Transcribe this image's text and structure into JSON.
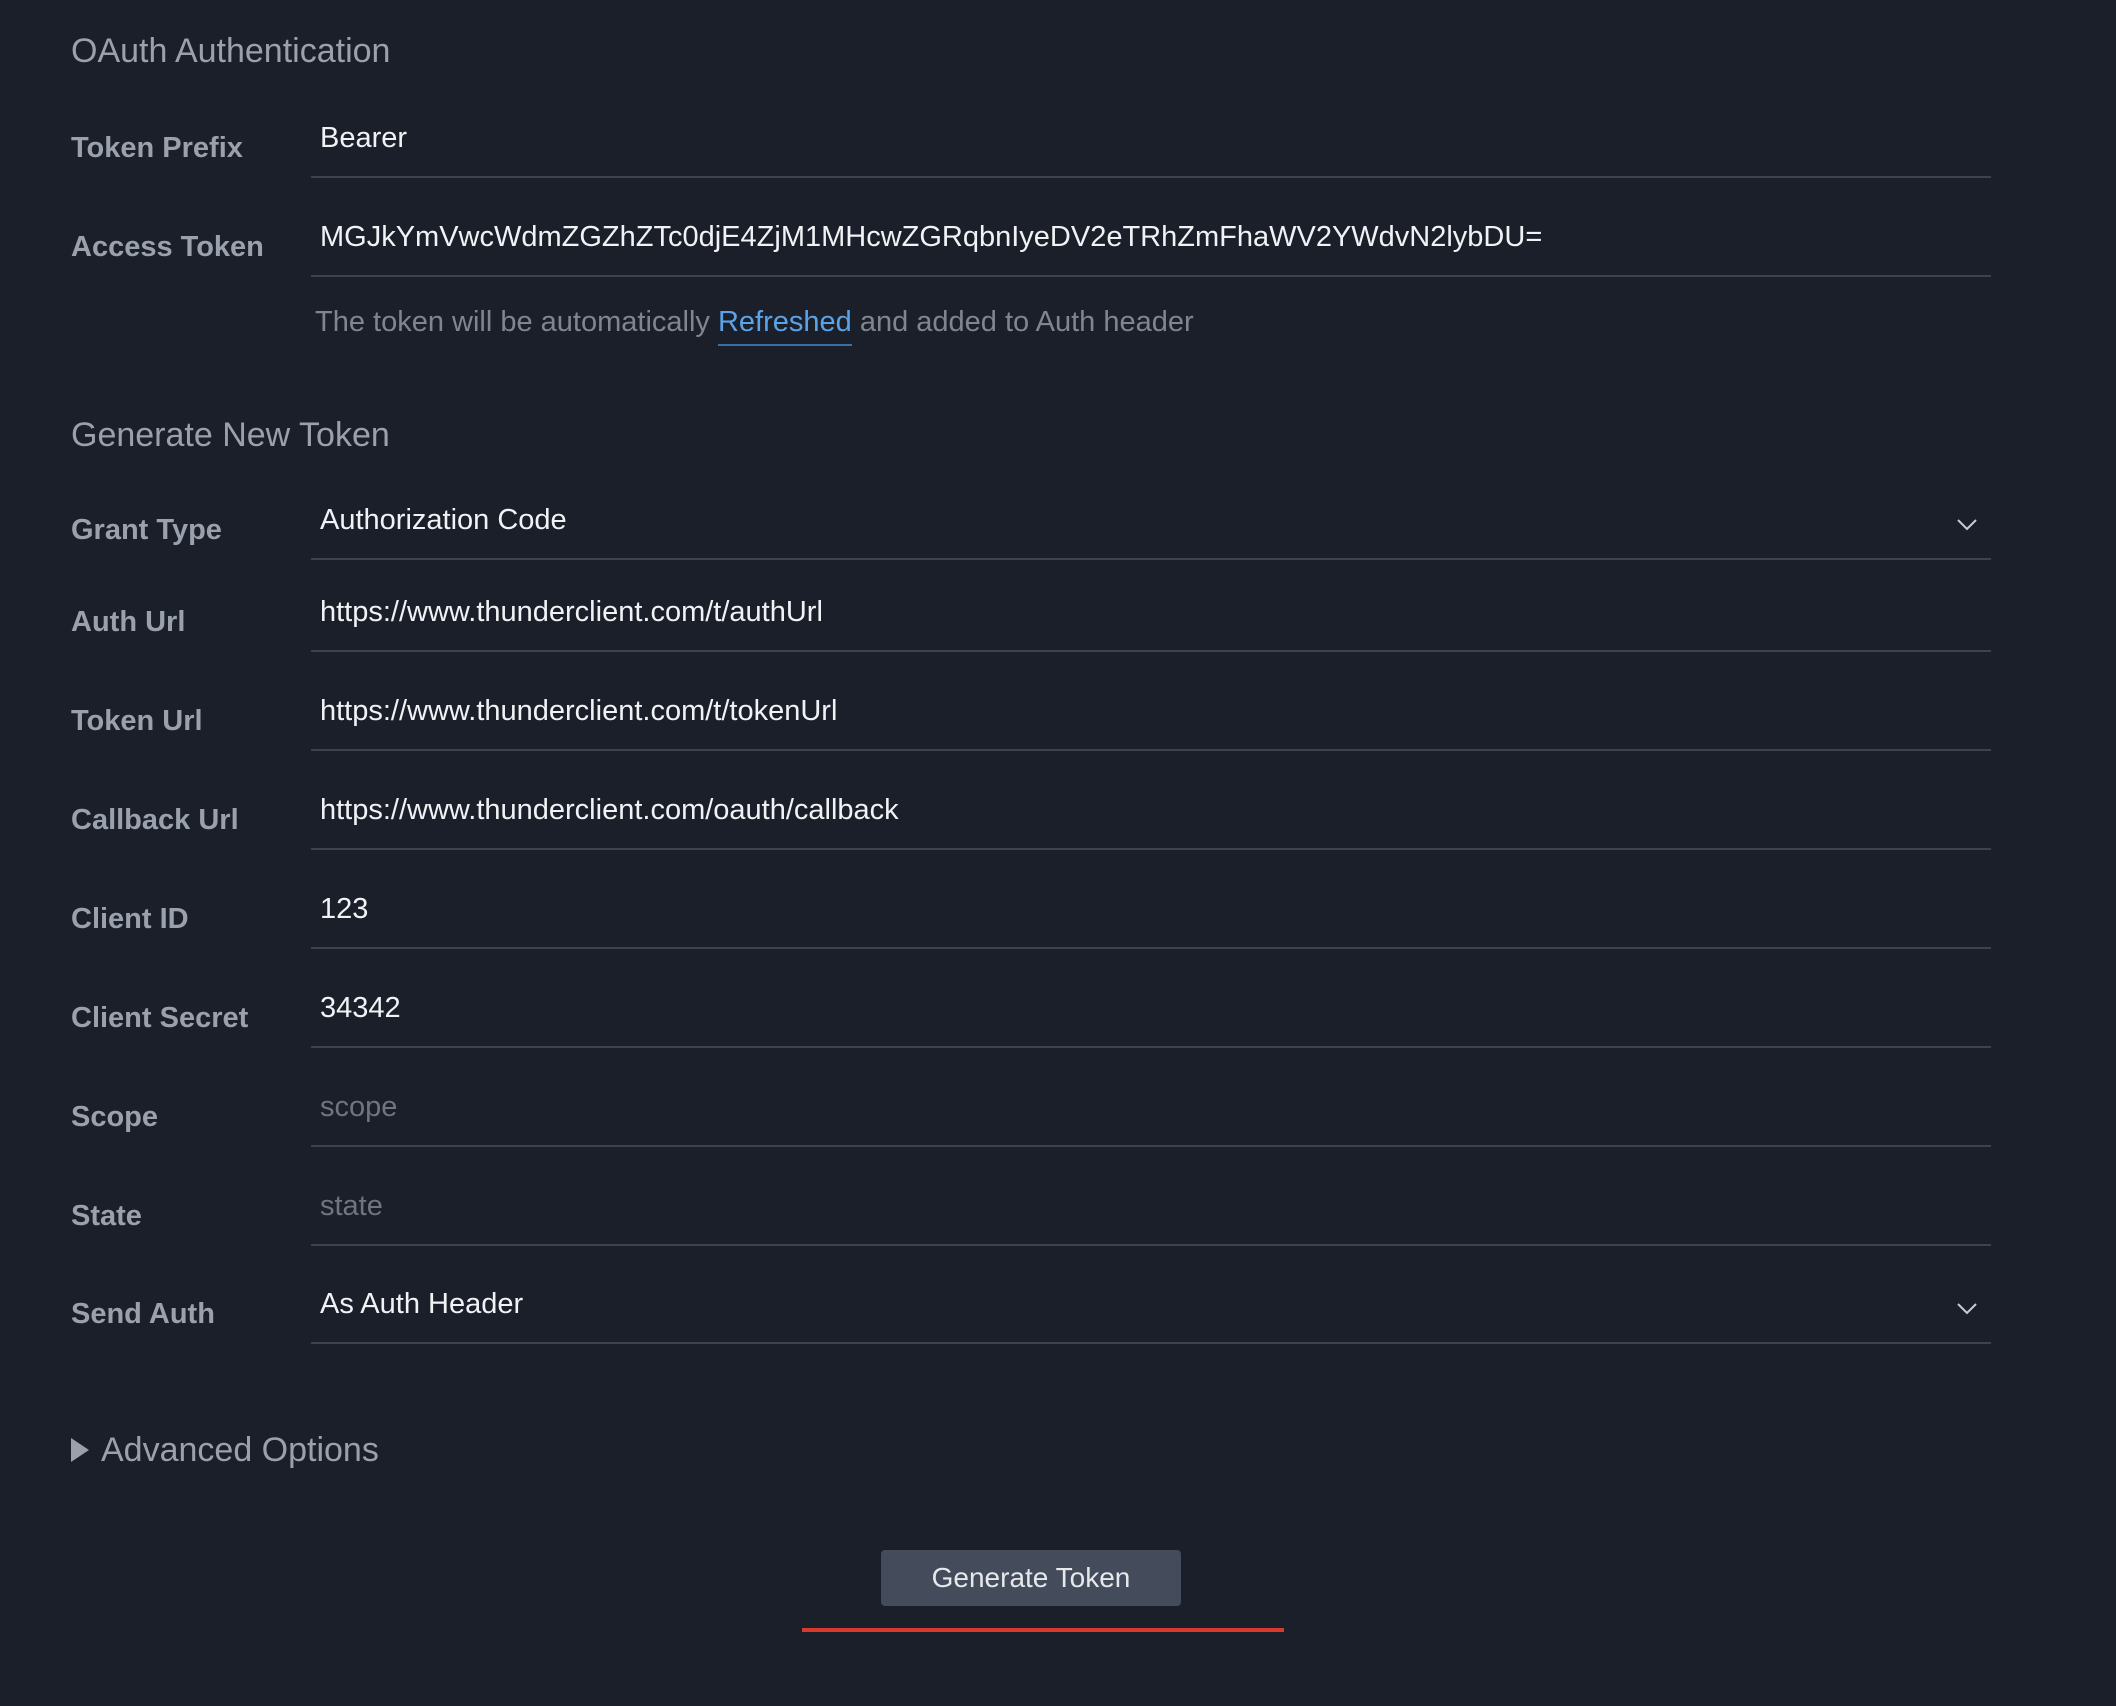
{
  "oauth": {
    "title": "OAuth Authentication",
    "token_prefix": {
      "label": "Token Prefix",
      "value": "Bearer"
    },
    "access_token": {
      "label": "Access Token",
      "value": "MGJkYmVwcWdmZGZhZTc0djE4ZjM1MHcwZGRqbnIyeDV2eTRhZmFhaWV2YWdvN2lybDU="
    },
    "hint": {
      "before": "The token will be automatically ",
      "link": "Refreshed",
      "after": " and added to Auth header"
    }
  },
  "generate": {
    "title": "Generate New Token",
    "grant_type": {
      "label": "Grant Type",
      "value": "Authorization Code"
    },
    "auth_url": {
      "label": "Auth Url",
      "value": "https://www.thunderclient.com/t/authUrl"
    },
    "token_url": {
      "label": "Token Url",
      "value": "https://www.thunderclient.com/t/tokenUrl"
    },
    "callback_url": {
      "label": "Callback Url",
      "value": "https://www.thunderclient.com/oauth/callback"
    },
    "client_id": {
      "label": "Client ID",
      "value": "123"
    },
    "client_secret": {
      "label": "Client Secret",
      "value": "34342"
    },
    "scope": {
      "label": "Scope",
      "value": "",
      "placeholder": "scope"
    },
    "state": {
      "label": "State",
      "value": "",
      "placeholder": "state"
    },
    "send_auth": {
      "label": "Send Auth",
      "value": "As Auth Header"
    },
    "advanced_options": "Advanced Options",
    "button_label": "Generate Token"
  },
  "colors": {
    "background": "#1b1f29",
    "link": "#5ba3e6",
    "button": "#444c5b",
    "accent_line": "#d93a2c"
  },
  "icons": {
    "dropdown": "chevron-down-icon",
    "disclosure": "triangle-right-icon"
  }
}
